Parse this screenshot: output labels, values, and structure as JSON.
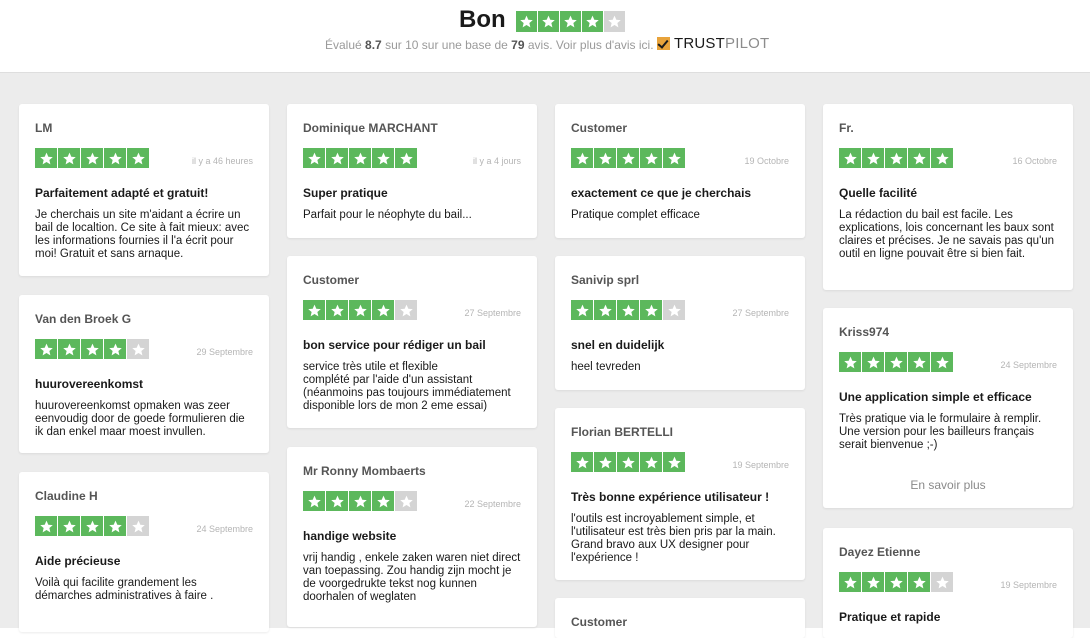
{
  "header": {
    "rating_word": "Bon",
    "rating": 4,
    "sub_prefix": "Évalué",
    "score": "8.7",
    "sub_mid": "sur 10 sur une base de",
    "count": "79",
    "sub_suffix": "avis. Voir plus d'avis ici.",
    "brand_part1": "TRUST",
    "brand_part2": "PILOT"
  },
  "colors": {
    "star_on": "#5cb85c",
    "star_off": "#d4d4d4",
    "background": "#ececec"
  },
  "reviews": [
    {
      "author": "LM",
      "rating": 5,
      "date": "il y a 46 heures",
      "title": "Parfaitement adapté et gratuit!",
      "body": "Je cherchais un site m'aidant a écrire un bail de localtion. Ce site à fait mieux: avec les informations fournies il l'a écrit pour moi! Gratuit et sans arnaque."
    },
    {
      "author": "Van den Broek G",
      "rating": 4,
      "date": "29 Septembre",
      "title": "huurovereenkomst",
      "body": "huurovereenkomst opmaken was zeer eenvoudig door de goede formulieren die ik dan enkel maar moest invullen."
    },
    {
      "author": "Claudine H",
      "rating": 4,
      "date": "24 Septembre",
      "title": "Aide précieuse",
      "body": "Voilà qui facilite grandement les démarches administratives à faire ."
    },
    {
      "author": "Dominique MARCHANT",
      "rating": 5,
      "date": "il y a 4 jours",
      "title": "Super pratique",
      "body": "Parfait pour le néophyte du bail..."
    },
    {
      "author": "Customer",
      "rating": 4,
      "date": "27 Septembre",
      "title": "bon service pour rédiger un bail",
      "body": "service très utile et flexible\ncomplété par l'aide d'un assistant\n(néanmoins pas toujours immédiatement disponible lors de mon 2 eme essai)"
    },
    {
      "author": "Mr Ronny Mombaerts",
      "rating": 4,
      "date": "22 Septembre",
      "title": "handige website",
      "body": "vrij handig , enkele zaken waren niet direct van toepassing. Zou handig zijn mocht je de voorgedrukte tekst nog kunnen doorhalen of weglaten"
    },
    {
      "author": "Customer",
      "rating": 5,
      "date": "19 Octobre",
      "title": "exactement ce que je cherchais",
      "body": "Pratique complet efficace"
    },
    {
      "author": "Sanivip sprl",
      "rating": 4,
      "date": "27 Septembre",
      "title": "snel en duidelijk",
      "body": "heel tevreden"
    },
    {
      "author": "Florian BERTELLI",
      "rating": 5,
      "date": "19 Septembre",
      "title": "Très bonne expérience utilisateur !",
      "body": "l'outils est incroyablement simple, et l'utilisateur est très bien pris par la main. Grand bravo aux UX designer pour l'expérience !"
    },
    {
      "author": "Fr.",
      "rating": 5,
      "date": "16 Octobre",
      "title": "Quelle facilité",
      "body": "La rédaction du bail est facile. Les explications, lois concernant les baux sont claires et précises. Je ne savais pas qu'un outil en ligne pouvait être si bien fait."
    },
    {
      "author": "Kriss974",
      "rating": 5,
      "date": "24 Septembre",
      "title": "Une application simple et efficace",
      "body": "Très pratique via le formulaire à remplir. Une version pour les bailleurs français serait bienvenue ;-)",
      "more": "En savoir plus"
    },
    {
      "author": "Dayez Etienne",
      "rating": 4,
      "date": "19 Septembre",
      "title": "Pratique et rapide",
      "body": ""
    },
    {
      "author": "Customer",
      "rating": 0,
      "date": "",
      "title": "",
      "body": ""
    }
  ]
}
